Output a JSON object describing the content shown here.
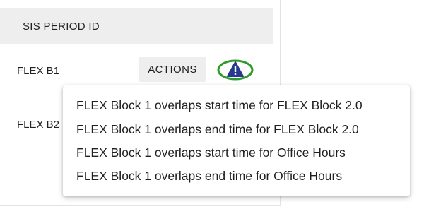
{
  "table": {
    "header": "SIS PERIOD ID",
    "rows": [
      {
        "label": "FLEX B1",
        "actions_label": "ACTIONS",
        "warning_icon": "warning-triangle-icon",
        "highlight_color": "#2e9a2e"
      },
      {
        "label": "FLEX B2"
      }
    ]
  },
  "popover": {
    "messages": [
      "FLEX Block 1 overlaps start time for FLEX Block 2.0",
      "FLEX Block 1 overlaps end time for FLEX Block 2.0",
      "FLEX Block 1 overlaps start time for Office Hours",
      "FLEX Block 1 overlaps end time for Office Hours"
    ]
  },
  "colors": {
    "warning_fill": "#27388f",
    "header_bg": "#eeeeee",
    "button_bg": "#eeeeee"
  }
}
